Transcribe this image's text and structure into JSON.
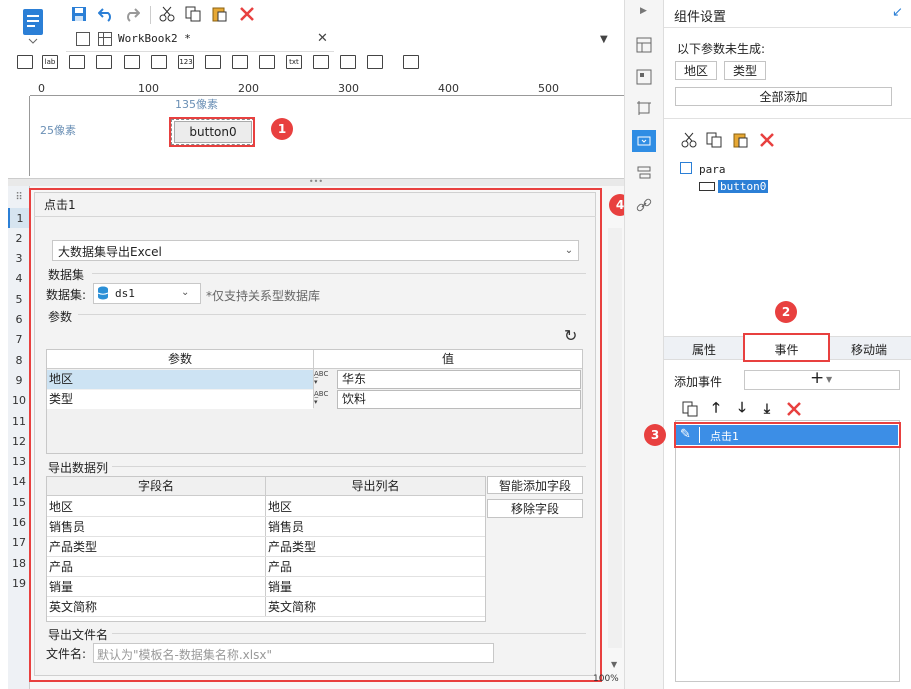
{
  "tab": {
    "title": "WorkBook2 *"
  },
  "ruler": {
    "ticks": [
      "0",
      "100",
      "200",
      "300",
      "400",
      "500"
    ],
    "x_hint": "135像素",
    "y_hint": "25像素"
  },
  "canvas": {
    "button_label": "button0"
  },
  "badges": [
    "1",
    "2",
    "3",
    "4"
  ],
  "event_panel": {
    "title": "点击1",
    "action_select": "大数据集导出Excel",
    "dataset_section": "数据集",
    "dataset_label": "数据集:",
    "dataset_value": "ds1",
    "dataset_note": "*仅支持关系型数据库",
    "params_section": "参数",
    "params_headers": [
      "参数",
      "值"
    ],
    "params_rows": [
      {
        "name": "地区",
        "value": "华东"
      },
      {
        "name": "类型",
        "value": "饮料"
      }
    ],
    "export_columns_section": "导出数据列",
    "columns_headers": [
      "字段名",
      "导出列名"
    ],
    "columns_rows": [
      [
        "地区",
        "地区"
      ],
      [
        "销售员",
        "销售员"
      ],
      [
        "产品类型",
        "产品类型"
      ],
      [
        "产品",
        "产品"
      ],
      [
        "销量",
        "销量"
      ],
      [
        "英文简称",
        "英文简称"
      ]
    ],
    "smart_add_button": "智能添加字段",
    "remove_field_button": "移除字段",
    "filename_section": "导出文件名",
    "filename_label": "文件名:",
    "filename_placeholder": "默认为\"模板名-数据集名称.xlsx\""
  },
  "row_numbers": [
    "1",
    "2",
    "3",
    "4",
    "5",
    "6",
    "7",
    "8",
    "9",
    "10",
    "11",
    "12",
    "13",
    "14",
    "15",
    "16",
    "17",
    "18",
    "19"
  ],
  "right_panel": {
    "title": "组件设置",
    "params_not_generated": "以下参数未生成:",
    "param_chips": [
      "地区",
      "类型"
    ],
    "add_all_button": "全部添加",
    "tree_root": "para",
    "tree_child": "button0",
    "tabs": [
      "属性",
      "事件",
      "移动端"
    ],
    "add_event_label": "添加事件",
    "add_event_plus": "+",
    "event_item": "点击1"
  },
  "status": {
    "zoom": "100%"
  },
  "colors": {
    "accent_red": "#e8403f",
    "select_blue": "#3c8ee6",
    "row_highlight": "#cde3f3"
  }
}
